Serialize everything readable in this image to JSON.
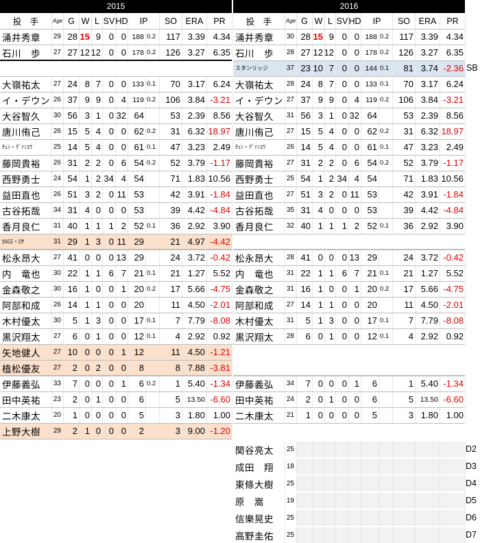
{
  "years": {
    "left": "2015",
    "right": "2016"
  },
  "columns": {
    "pitcher": "投　手",
    "age": "Age",
    "g": "G",
    "w": "W",
    "l": "L",
    "sv": "SV",
    "hd": "HD",
    "ip": "IP",
    "so": "SO",
    "era": "ERA",
    "pr": "PR"
  },
  "colors": {
    "negative": "#e00000",
    "highlight_new": "#fbe0cc",
    "highlight_added": "#dbe5f1",
    "header_bg": "#000000"
  },
  "left": [
    {
      "name": "涌井秀章",
      "age": "29",
      "g": "28",
      "w": "15",
      "l": "9",
      "sv": "0",
      "hd": "0",
      "ip": "188",
      "ipf": "0.2",
      "so": "117",
      "era": "3.39",
      "pr": "4.34",
      "wbold": true,
      "row": 0
    },
    {
      "name": "石川　歩",
      "age": "27",
      "g": "27",
      "w": "12",
      "l": "12",
      "sv": "0",
      "hd": "0",
      "ip": "178",
      "ipf": "0.2",
      "so": "126",
      "era": "3.27",
      "pr": "6.35",
      "row": 1
    },
    {
      "name": "大嶺祐太",
      "age": "27",
      "g": "24",
      "w": "8",
      "l": "7",
      "sv": "0",
      "hd": "0",
      "ip": "133",
      "ipf": "0.1",
      "so": "70",
      "era": "3.17",
      "pr": "6.24",
      "row": 3
    },
    {
      "name": "イ・デウン",
      "age": "26",
      "g": "37",
      "w": "9",
      "l": "9",
      "sv": "0",
      "hd": "4",
      "ip": "119",
      "ipf": "0.2",
      "so": "106",
      "era": "3.84",
      "pr": "-3.21",
      "row": 4
    },
    {
      "name": "大谷智久",
      "age": "30",
      "g": "56",
      "w": "3",
      "l": "1",
      "sv": "0",
      "hd": "32",
      "ip": "64",
      "ipf": "",
      "so": "53",
      "era": "2.39",
      "pr": "8.56",
      "row": 5
    },
    {
      "name": "唐川侑己",
      "age": "26",
      "g": "15",
      "w": "5",
      "l": "4",
      "sv": "0",
      "hd": "0",
      "ip": "62",
      "ipf": "0.2",
      "so": "31",
      "era": "6.32",
      "pr": "-18.97",
      "row": 6
    },
    {
      "name": "ﾁｪﾝ・ｸﾞｧﾝﾕｳ",
      "age": "25",
      "g": "14",
      "w": "5",
      "l": "4",
      "sv": "0",
      "hd": "0",
      "ip": "61",
      "ipf": "0.1",
      "so": "47",
      "era": "3.23",
      "pr": "2.49",
      "small": true,
      "row": 7
    },
    {
      "name": "藤岡貴裕",
      "age": "26",
      "g": "31",
      "w": "2",
      "l": "2",
      "sv": "0",
      "hd": "6",
      "ip": "54",
      "ipf": "0.2",
      "so": "52",
      "era": "3.79",
      "pr": "-1.17",
      "row": 8
    },
    {
      "name": "西野勇士",
      "age": "24",
      "g": "54",
      "w": "1",
      "l": "2",
      "sv": "34",
      "hd": "4",
      "ip": "54",
      "ipf": "",
      "so": "71",
      "era": "1.83",
      "pr": "10.56",
      "row": 9
    },
    {
      "name": "益田直也",
      "age": "26",
      "g": "51",
      "w": "3",
      "l": "2",
      "sv": "0",
      "hd": "11",
      "ip": "53",
      "ipf": "",
      "so": "42",
      "era": "3.91",
      "pr": "-1.84",
      "row": 10
    },
    {
      "name": "古谷拓哉",
      "age": "34",
      "g": "31",
      "w": "4",
      "l": "0",
      "sv": "0",
      "hd": "0",
      "ip": "53",
      "ipf": "",
      "so": "39",
      "era": "4.42",
      "pr": "-4.84",
      "row": 11
    },
    {
      "name": "香月良仁",
      "age": "31",
      "g": "40",
      "w": "1",
      "l": "1",
      "sv": "1",
      "hd": "2",
      "ip": "52",
      "ipf": "0.1",
      "so": "36",
      "era": "2.92",
      "pr": "3.90",
      "row": 12
    },
    {
      "name": "ｶﾙﾛｽ・ﾛｻ",
      "age": "31",
      "g": "29",
      "w": "1",
      "l": "3",
      "sv": "0",
      "hd": "11",
      "ip": "29",
      "ipf": "",
      "so": "21",
      "era": "4.97",
      "pr": "-4.42",
      "small": true,
      "pink": true,
      "row": 13
    },
    {
      "name": "松永昂大",
      "age": "27",
      "g": "41",
      "w": "0",
      "l": "0",
      "sv": "0",
      "hd": "13",
      "ip": "29",
      "ipf": "",
      "so": "24",
      "era": "3.72",
      "pr": "-0.42",
      "row": 14
    },
    {
      "name": "内　竜也",
      "age": "30",
      "g": "22",
      "w": "1",
      "l": "1",
      "sv": "6",
      "hd": "7",
      "ip": "21",
      "ipf": "0.1",
      "so": "21",
      "era": "1.27",
      "pr": "5.52",
      "row": 15
    },
    {
      "name": "金森敬之",
      "age": "30",
      "g": "16",
      "w": "1",
      "l": "0",
      "sv": "0",
      "hd": "1",
      "ip": "20",
      "ipf": "0.2",
      "so": "17",
      "era": "5.66",
      "pr": "-4.75",
      "row": 16
    },
    {
      "name": "阿部和成",
      "age": "26",
      "g": "14",
      "w": "1",
      "l": "1",
      "sv": "0",
      "hd": "0",
      "ip": "20",
      "ipf": "",
      "so": "11",
      "era": "4.50",
      "pr": "-2.01",
      "row": 17
    },
    {
      "name": "木村優太",
      "age": "30",
      "g": "5",
      "w": "1",
      "l": "3",
      "sv": "0",
      "hd": "0",
      "ip": "17",
      "ipf": "0.1",
      "so": "7",
      "era": "7.79",
      "pr": "-8.08",
      "row": 18
    },
    {
      "name": "黒沢翔太",
      "age": "27",
      "g": "6",
      "w": "0",
      "l": "1",
      "sv": "0",
      "hd": "0",
      "ip": "12",
      "ipf": "0.1",
      "so": "4",
      "era": "2.92",
      "pr": "0.92",
      "row": 19
    },
    {
      "name": "矢地健人",
      "age": "27",
      "g": "10",
      "w": "0",
      "l": "0",
      "sv": "0",
      "hd": "1",
      "ip": "12",
      "ipf": "",
      "so": "11",
      "era": "4.50",
      "pr": "-1.21",
      "pink": true,
      "row": 20
    },
    {
      "name": "植松優友",
      "age": "27",
      "g": "2",
      "w": "0",
      "l": "2",
      "sv": "0",
      "hd": "0",
      "ip": "8",
      "ipf": "",
      "so": "8",
      "era": "7.88",
      "pr": "-3.81",
      "pink": true,
      "row": 21
    },
    {
      "name": "伊藤義弘",
      "age": "33",
      "g": "7",
      "w": "0",
      "l": "0",
      "sv": "0",
      "hd": "1",
      "ip": "6",
      "ipf": "0.2",
      "so": "1",
      "era": "5.40",
      "pr": "-1.34",
      "row": 22
    },
    {
      "name": "田中英祐",
      "age": "23",
      "g": "2",
      "w": "0",
      "l": "1",
      "sv": "0",
      "hd": "0",
      "ip": "6",
      "ipf": "",
      "so": "5",
      "era": "13.50",
      "pr": "-6.60",
      "smallera": true,
      "row": 23
    },
    {
      "name": "二木康太",
      "age": "20",
      "g": "1",
      "w": "0",
      "l": "0",
      "sv": "0",
      "hd": "0",
      "ip": "5",
      "ipf": "",
      "so": "3",
      "era": "1.80",
      "pr": "1.00",
      "row": 24
    },
    {
      "name": "上野大樹",
      "age": "29",
      "g": "2",
      "w": "1",
      "l": "0",
      "sv": "0",
      "hd": "0",
      "ip": "2",
      "ipf": "",
      "so": "3",
      "era": "9.00",
      "pr": "-1.20",
      "pink": true,
      "row": 25
    }
  ],
  "right": [
    {
      "name": "涌井秀章",
      "age": "30",
      "g": "28",
      "w": "15",
      "l": "9",
      "sv": "0",
      "hd": "0",
      "ip": "188",
      "ipf": "0.2",
      "so": "117",
      "era": "3.39",
      "pr": "4.34",
      "wbold": true,
      "row": 0
    },
    {
      "name": "石川　歩",
      "age": "28",
      "g": "27",
      "w": "12",
      "l": "12",
      "sv": "0",
      "hd": "0",
      "ip": "178",
      "ipf": "0.2",
      "so": "126",
      "era": "3.27",
      "pr": "6.35",
      "row": 1
    },
    {
      "name": "スタンリッジ",
      "age": "37",
      "g": "23",
      "w": "10",
      "l": "7",
      "sv": "0",
      "hd": "0",
      "ip": "144",
      "ipf": "0.1",
      "so": "81",
      "era": "3.74",
      "pr": "-2.36",
      "small": true,
      "blue": true,
      "tag": "SB",
      "row": 2
    },
    {
      "name": "大嶺祐太",
      "age": "28",
      "g": "24",
      "w": "8",
      "l": "7",
      "sv": "0",
      "hd": "0",
      "ip": "133",
      "ipf": "0.1",
      "so": "70",
      "era": "3.17",
      "pr": "6.24",
      "row": 3
    },
    {
      "name": "イ・デウン",
      "age": "27",
      "g": "37",
      "w": "9",
      "l": "9",
      "sv": "0",
      "hd": "4",
      "ip": "119",
      "ipf": "0.2",
      "so": "106",
      "era": "3.84",
      "pr": "-3.21",
      "row": 4
    },
    {
      "name": "大谷智久",
      "age": "31",
      "g": "56",
      "w": "3",
      "l": "1",
      "sv": "0",
      "hd": "32",
      "ip": "64",
      "ipf": "",
      "so": "53",
      "era": "2.39",
      "pr": "8.56",
      "row": 5
    },
    {
      "name": "唐川侑己",
      "age": "27",
      "g": "15",
      "w": "5",
      "l": "4",
      "sv": "0",
      "hd": "0",
      "ip": "62",
      "ipf": "0.2",
      "so": "31",
      "era": "6.32",
      "pr": "-18.97",
      "row": 6
    },
    {
      "name": "ﾁｪﾝ・ｸﾞｧﾝﾕｳ",
      "age": "26",
      "g": "14",
      "w": "5",
      "l": "4",
      "sv": "0",
      "hd": "0",
      "ip": "61",
      "ipf": "0.1",
      "so": "47",
      "era": "3.23",
      "pr": "2.49",
      "small": true,
      "row": 7
    },
    {
      "name": "藤岡貴裕",
      "age": "27",
      "g": "31",
      "w": "2",
      "l": "2",
      "sv": "0",
      "hd": "6",
      "ip": "54",
      "ipf": "0.2",
      "so": "52",
      "era": "3.79",
      "pr": "-1.17",
      "row": 8
    },
    {
      "name": "西野勇士",
      "age": "25",
      "g": "54",
      "w": "1",
      "l": "2",
      "sv": "34",
      "hd": "4",
      "ip": "54",
      "ipf": "",
      "so": "71",
      "era": "1.83",
      "pr": "10.56",
      "row": 9
    },
    {
      "name": "益田直也",
      "age": "27",
      "g": "51",
      "w": "3",
      "l": "2",
      "sv": "0",
      "hd": "11",
      "ip": "53",
      "ipf": "",
      "so": "42",
      "era": "3.91",
      "pr": "-1.84",
      "row": 10
    },
    {
      "name": "古谷拓哉",
      "age": "35",
      "g": "31",
      "w": "4",
      "l": "0",
      "sv": "0",
      "hd": "0",
      "ip": "53",
      "ipf": "",
      "so": "39",
      "era": "4.42",
      "pr": "-4.84",
      "row": 11
    },
    {
      "name": "香月良仁",
      "age": "32",
      "g": "40",
      "w": "1",
      "l": "1",
      "sv": "1",
      "hd": "2",
      "ip": "52",
      "ipf": "0.1",
      "so": "36",
      "era": "2.92",
      "pr": "3.90",
      "row": 12
    },
    {
      "name": "松永昂大",
      "age": "28",
      "g": "41",
      "w": "0",
      "l": "0",
      "sv": "0",
      "hd": "13",
      "ip": "29",
      "ipf": "",
      "so": "24",
      "era": "3.72",
      "pr": "-0.42",
      "row": 14
    },
    {
      "name": "内　竜也",
      "age": "31",
      "g": "22",
      "w": "1",
      "l": "1",
      "sv": "6",
      "hd": "7",
      "ip": "21",
      "ipf": "0.1",
      "so": "21",
      "era": "1.27",
      "pr": "5.52",
      "row": 15
    },
    {
      "name": "金森敬之",
      "age": "31",
      "g": "16",
      "w": "1",
      "l": "0",
      "sv": "0",
      "hd": "1",
      "ip": "20",
      "ipf": "0.2",
      "so": "17",
      "era": "5.66",
      "pr": "-4.75",
      "row": 16
    },
    {
      "name": "阿部和成",
      "age": "27",
      "g": "14",
      "w": "1",
      "l": "1",
      "sv": "0",
      "hd": "0",
      "ip": "20",
      "ipf": "",
      "so": "11",
      "era": "4.50",
      "pr": "-2.01",
      "row": 17
    },
    {
      "name": "木村優太",
      "age": "31",
      "g": "5",
      "w": "1",
      "l": "3",
      "sv": "0",
      "hd": "0",
      "ip": "17",
      "ipf": "0.1",
      "so": "7",
      "era": "7.79",
      "pr": "-8.08",
      "row": 18
    },
    {
      "name": "黒沢翔太",
      "age": "28",
      "g": "6",
      "w": "0",
      "l": "1",
      "sv": "0",
      "hd": "0",
      "ip": "12",
      "ipf": "0.1",
      "so": "4",
      "era": "2.92",
      "pr": "0.92",
      "row": 19
    },
    {
      "name": "伊藤義弘",
      "age": "34",
      "g": "7",
      "w": "0",
      "l": "0",
      "sv": "0",
      "hd": "1",
      "ip": "6",
      "ipf": "",
      "so": "1",
      "era": "5.40",
      "pr": "-1.34",
      "row": 22
    },
    {
      "name": "田中英祐",
      "age": "24",
      "g": "2",
      "w": "0",
      "l": "1",
      "sv": "0",
      "hd": "0",
      "ip": "6",
      "ipf": "",
      "so": "5",
      "era": "13.50",
      "pr": "-6.60",
      "smallera": true,
      "row": 23
    },
    {
      "name": "二木康太",
      "age": "21",
      "g": "1",
      "w": "0",
      "l": "0",
      "sv": "0",
      "hd": "0",
      "ip": "5",
      "ipf": "",
      "so": "3",
      "era": "1.80",
      "pr": "1.00",
      "row": 24
    }
  ],
  "draft": [
    {
      "name": "関谷亮太",
      "age": "25",
      "tag": "D2"
    },
    {
      "name": "成田　翔",
      "age": "18",
      "tag": "D3"
    },
    {
      "name": "東條大樹",
      "age": "25",
      "tag": "D4"
    },
    {
      "name": "原　嵩",
      "age": "19",
      "tag": "D5"
    },
    {
      "name": "信樂晃史",
      "age": "25",
      "tag": "D6"
    },
    {
      "name": "高野圭佑",
      "age": "25",
      "tag": "D7"
    }
  ]
}
